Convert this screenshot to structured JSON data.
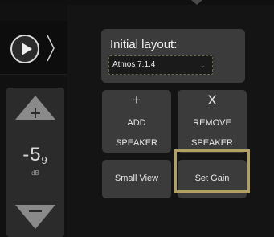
{
  "transport": {
    "play_icon": "play-icon",
    "expand_icon": "chevron-right-icon"
  },
  "volume": {
    "up_icon": "plus-icon",
    "down_icon": "minus-icon",
    "value_int": "-5",
    "value_dec": "9",
    "unit": "dB"
  },
  "layout": {
    "title": "Initial layout:",
    "selected": "Atmos 7.1.4",
    "caret_icon": "chevron-down-icon"
  },
  "actions": {
    "add": {
      "glyph": "+",
      "line1": "ADD",
      "line2": "SPEAKER"
    },
    "remove": {
      "glyph": "X",
      "line1": "REMOVE",
      "line2": "SPEAKER"
    },
    "small_view": "Small View",
    "set_gain": "Set Gain"
  },
  "colors": {
    "highlight": "#b29f62",
    "tile_bg": "#3b3b3b",
    "background": "#0b0b0b"
  }
}
